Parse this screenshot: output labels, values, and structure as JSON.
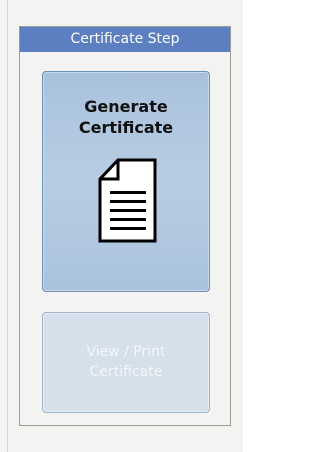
{
  "panel": {
    "title": "Certificate Step"
  },
  "buttons": {
    "generate": {
      "line1": "Generate",
      "line2": "Certificate",
      "icon": "document-icon"
    },
    "view_print": {
      "line1": "View / Print",
      "line2": "Certificate",
      "state": "disabled"
    }
  },
  "colors": {
    "header_bg": "#5b7fc0",
    "generate_bg": "#b8cde3",
    "disabled_bg": "#d6e0ea"
  }
}
